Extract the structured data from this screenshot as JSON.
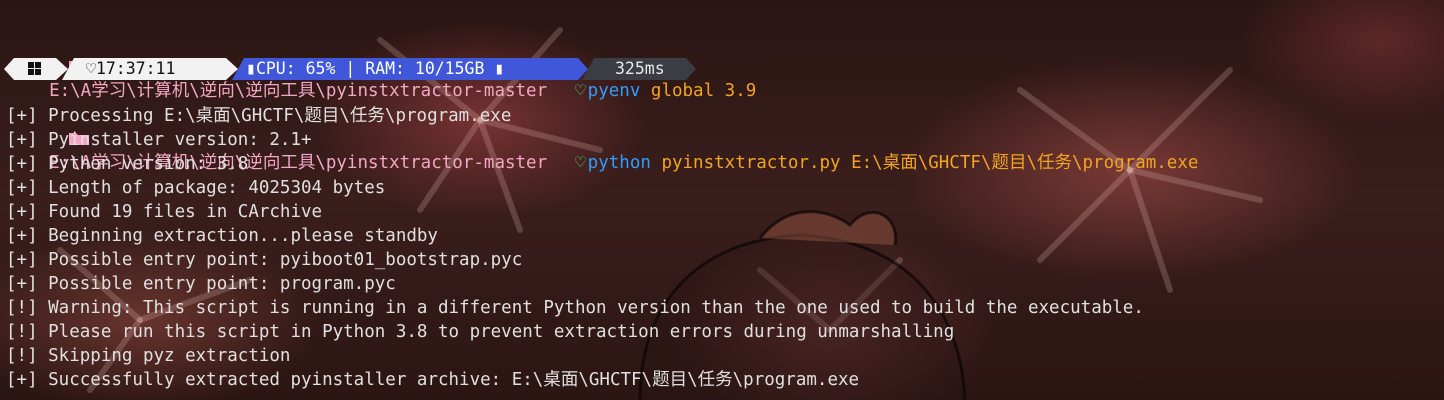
{
  "prompt1": {
    "path": "E:\\A学习\\计算机\\逆向\\逆向工具\\pyinstxtractor-master",
    "command": "pyenv",
    "args": "global 3.9"
  },
  "statusbar": {
    "time": "17:37:11",
    "sysinfo": "CPU: 65% | RAM: 10/15GB",
    "duration": "325ms"
  },
  "prompt2": {
    "path": "E:\\A学习\\计算机\\逆向\\逆向工具\\pyinstxtractor-master",
    "command": "python",
    "args": "pyinstxtractor.py E:\\桌面\\GHCTF\\题目\\任务\\program.exe"
  },
  "output": [
    "[+] Processing E:\\桌面\\GHCTF\\题目\\任务\\program.exe",
    "[+] Pyinstaller version: 2.1+",
    "[+] Python version: 3.8",
    "[+] Length of package: 4025304 bytes",
    "[+] Found 19 files in CArchive",
    "[+] Beginning extraction...please standby",
    "[+] Possible entry point: pyiboot01_bootstrap.pyc",
    "[+] Possible entry point: program.pyc",
    "[!] Warning: This script is running in a different Python version than the one used to build the executable.",
    "[!] Please run this script in Python 3.8 to prevent extraction errors during unmarshalling",
    "[!] Skipping pyz extraction",
    "[+] Successfully extracted pyinstaller archive: E:\\桌面\\GHCTF\\题目\\任务\\program.exe"
  ],
  "icons": {
    "folder": "folder-icon",
    "heart": "heart-icon",
    "windows": "windows-logo-icon",
    "clock": "heart-clock-icon",
    "cpu": "chip-icon"
  },
  "colors": {
    "path": "#f4a6c6",
    "heart": "#3ee07a",
    "command": "#2f9dff",
    "args": "#f2a423",
    "segment_light": "#f2f2f2",
    "segment_blue": "#3f57d8",
    "segment_gray": "#3b3d44"
  }
}
